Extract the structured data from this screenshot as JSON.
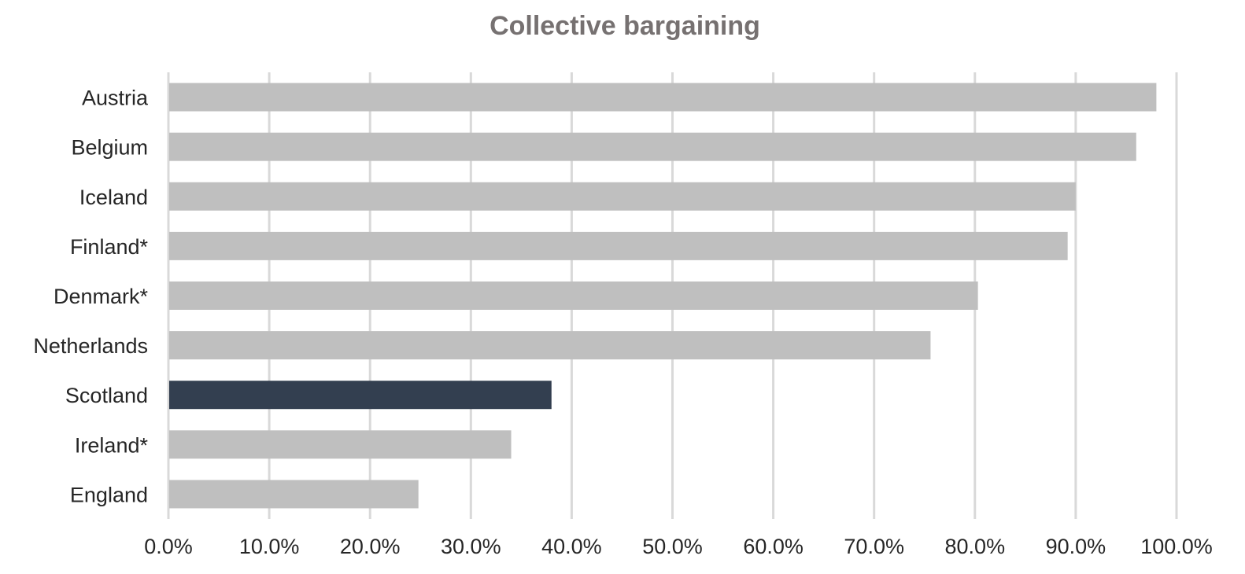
{
  "chart_data": {
    "type": "bar",
    "orientation": "horizontal",
    "title": "Collective bargaining",
    "xlabel": "",
    "ylabel": "",
    "categories": [
      "Austria",
      "Belgium",
      "Iceland",
      "Finland*",
      "Denmark*",
      "Netherlands",
      "Scotland",
      "Ireland*",
      "England"
    ],
    "values": [
      98.0,
      96.0,
      90.0,
      89.2,
      80.3,
      75.6,
      38.0,
      34.0,
      24.8
    ],
    "highlight": "Scotland",
    "colors": {
      "default": "#bfbfbf",
      "highlight": "#333f50",
      "grid": "#d9d9d9"
    },
    "xlim": [
      0,
      100
    ],
    "xticks": [
      "0.0%",
      "10.0%",
      "20.0%",
      "30.0%",
      "40.0%",
      "50.0%",
      "60.0%",
      "70.0%",
      "80.0%",
      "90.0%",
      "100.0%"
    ],
    "grid": true,
    "legend": "none"
  }
}
